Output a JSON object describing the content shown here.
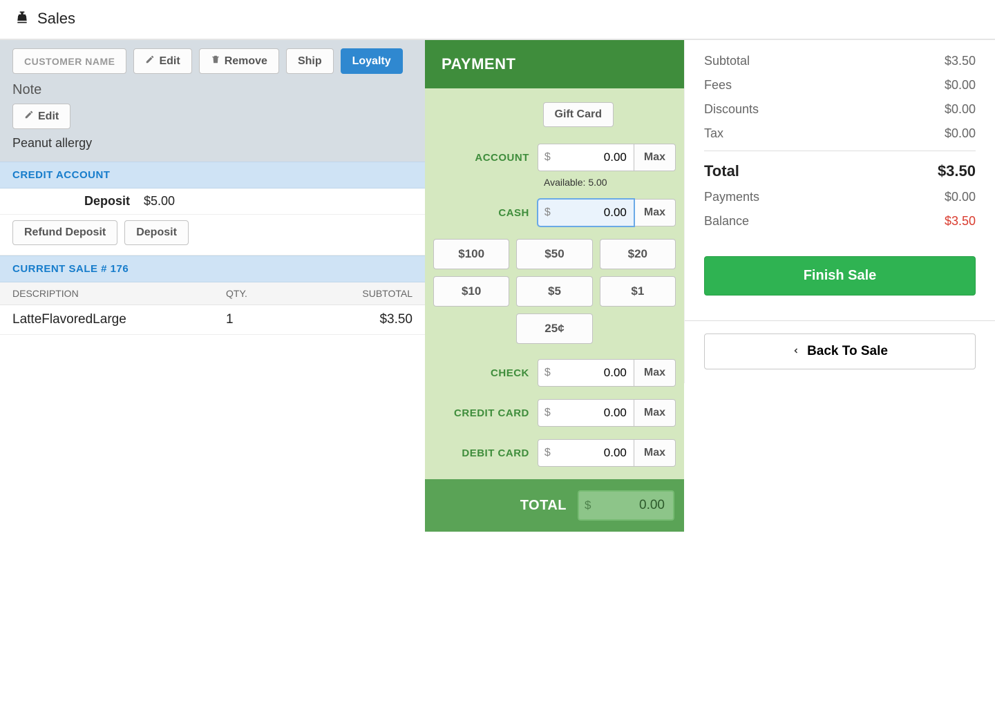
{
  "app_title": "Sales",
  "customer": {
    "name_placeholder": "CUSTOMER NAME",
    "edit": "Edit",
    "remove": "Remove",
    "ship": "Ship",
    "loyalty": "Loyalty",
    "note_heading": "Note",
    "note_edit": "Edit",
    "note_text": "Peanut allergy"
  },
  "credit": {
    "heading": "CREDIT ACCOUNT",
    "deposit_label": "Deposit",
    "deposit_amount": "$5.00",
    "refund_btn": "Refund Deposit",
    "deposit_btn": "Deposit"
  },
  "sale": {
    "heading": "CURRENT SALE # 176",
    "cols": {
      "desc": "DESCRIPTION",
      "qty": "QTY.",
      "sub": "SUBTOTAL"
    },
    "rows": [
      {
        "desc": "LatteFlavoredLarge",
        "qty": "1",
        "sub": "$3.50"
      }
    ]
  },
  "payment": {
    "heading": "PAYMENT",
    "gift_card": "Gift Card",
    "account_label": "ACCOUNT",
    "account_value": "0.00",
    "available": "Available: 5.00",
    "cash_label": "CASH",
    "cash_value": "0.00",
    "quick": [
      "$100",
      "$50",
      "$20",
      "$10",
      "$5",
      "$1",
      "25¢"
    ],
    "check_label": "CHECK",
    "check_value": "0.00",
    "credit_label": "CREDIT CARD",
    "credit_value": "0.00",
    "debit_label": "DEBIT CARD",
    "debit_value": "0.00",
    "max": "Max",
    "total_label": "TOTAL",
    "total_value": "0.00"
  },
  "summary": {
    "subtotal_l": "Subtotal",
    "subtotal_v": "$3.50",
    "fees_l": "Fees",
    "fees_v": "$0.00",
    "disc_l": "Discounts",
    "disc_v": "$0.00",
    "tax_l": "Tax",
    "tax_v": "$0.00",
    "total_l": "Total",
    "total_v": "$3.50",
    "pay_l": "Payments",
    "pay_v": "$0.00",
    "bal_l": "Balance",
    "bal_v": "$3.50",
    "finish": "Finish Sale",
    "back": "Back To Sale"
  }
}
